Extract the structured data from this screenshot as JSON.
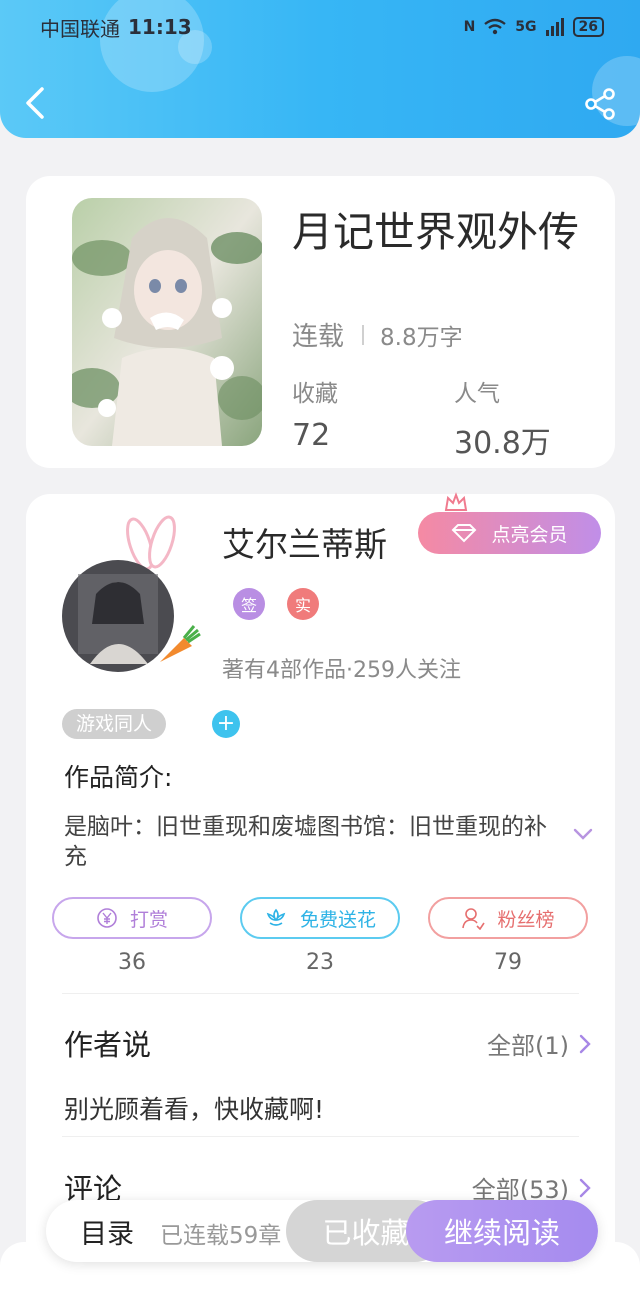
{
  "status_bar": {
    "carrier": "中国联通",
    "time": "11:13",
    "nfc": "N",
    "signal": "5G",
    "battery": "26"
  },
  "book": {
    "title": "月记世界观外传",
    "status": "连载",
    "word_count": "8.8万字",
    "stats": [
      {
        "label": "收藏",
        "value": "72"
      },
      {
        "label": "人气",
        "value": "30.8万"
      }
    ]
  },
  "author": {
    "name": "艾尔兰蒂斯",
    "vip_label": "点亮会员",
    "badges": [
      "签",
      "实"
    ],
    "summary": "著有4部作品·259人关注",
    "tag": "游戏同人",
    "add_tag": "+"
  },
  "intro": {
    "title": "作品简介:",
    "text": "是脑叶：旧世重现和废墟图书馆：旧世重现的补充"
  },
  "actions": [
    {
      "label": "打赏",
      "count": "36",
      "icon": "yen-icon"
    },
    {
      "label": "免费送花",
      "count": "23",
      "icon": "flower-icon"
    },
    {
      "label": "粉丝榜",
      "count": "79",
      "icon": "fans-icon"
    }
  ],
  "author_says": {
    "title": "作者说",
    "more": "全部(1)",
    "text": "别光顾着看，快收藏啊!"
  },
  "comments": {
    "title": "评论",
    "more": "全部(53)"
  },
  "bottom_bar": {
    "toc": "目录",
    "serial": "已连载59章",
    "collected": "已收藏",
    "read": "继续阅读"
  },
  "colors": {
    "header": "#37b6f5",
    "accent_purple": "#b07fd9",
    "accent_teal": "#3ec3ee",
    "accent_red": "#f07b7b"
  }
}
